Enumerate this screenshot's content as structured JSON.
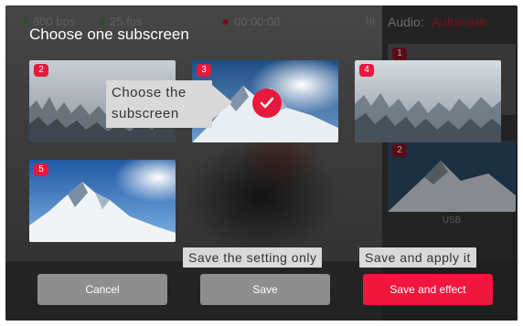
{
  "topbar": {
    "bitrate": "800 bps",
    "fps": "25 fps",
    "timer": "00:00:08",
    "bitrate_dot_color": "#2e8b3a",
    "fps_dot_color": "#2e8b3a",
    "rec_dot_color": "#b01a2a"
  },
  "side_panel": {
    "audio_label": "Audio:",
    "audio_value": "Automatic",
    "thumb_1_badge": "1",
    "thumb_2_badge": "2",
    "thumb_2_label": "USB"
  },
  "dialog": {
    "title": "Choose one subscreen",
    "subscreens": [
      {
        "badge": "2",
        "scene": "foggy-forest"
      },
      {
        "badge": "3",
        "scene": "snowy-mountain-sun",
        "selected": true
      },
      {
        "badge": "4",
        "scene": "foggy-forest"
      },
      {
        "badge": "5",
        "scene": "snowy-mountain-sky"
      }
    ],
    "selected_icon": "checkmark-icon",
    "accent_color": "#e8193c"
  },
  "callouts": {
    "choose_line1": "Choose the",
    "choose_line2": "subscreen",
    "save_only": "Save the setting  only",
    "save_apply": "Save and apply it"
  },
  "buttons": {
    "cancel": "Cancel",
    "save": "Save",
    "save_effect": "Save and effect"
  }
}
